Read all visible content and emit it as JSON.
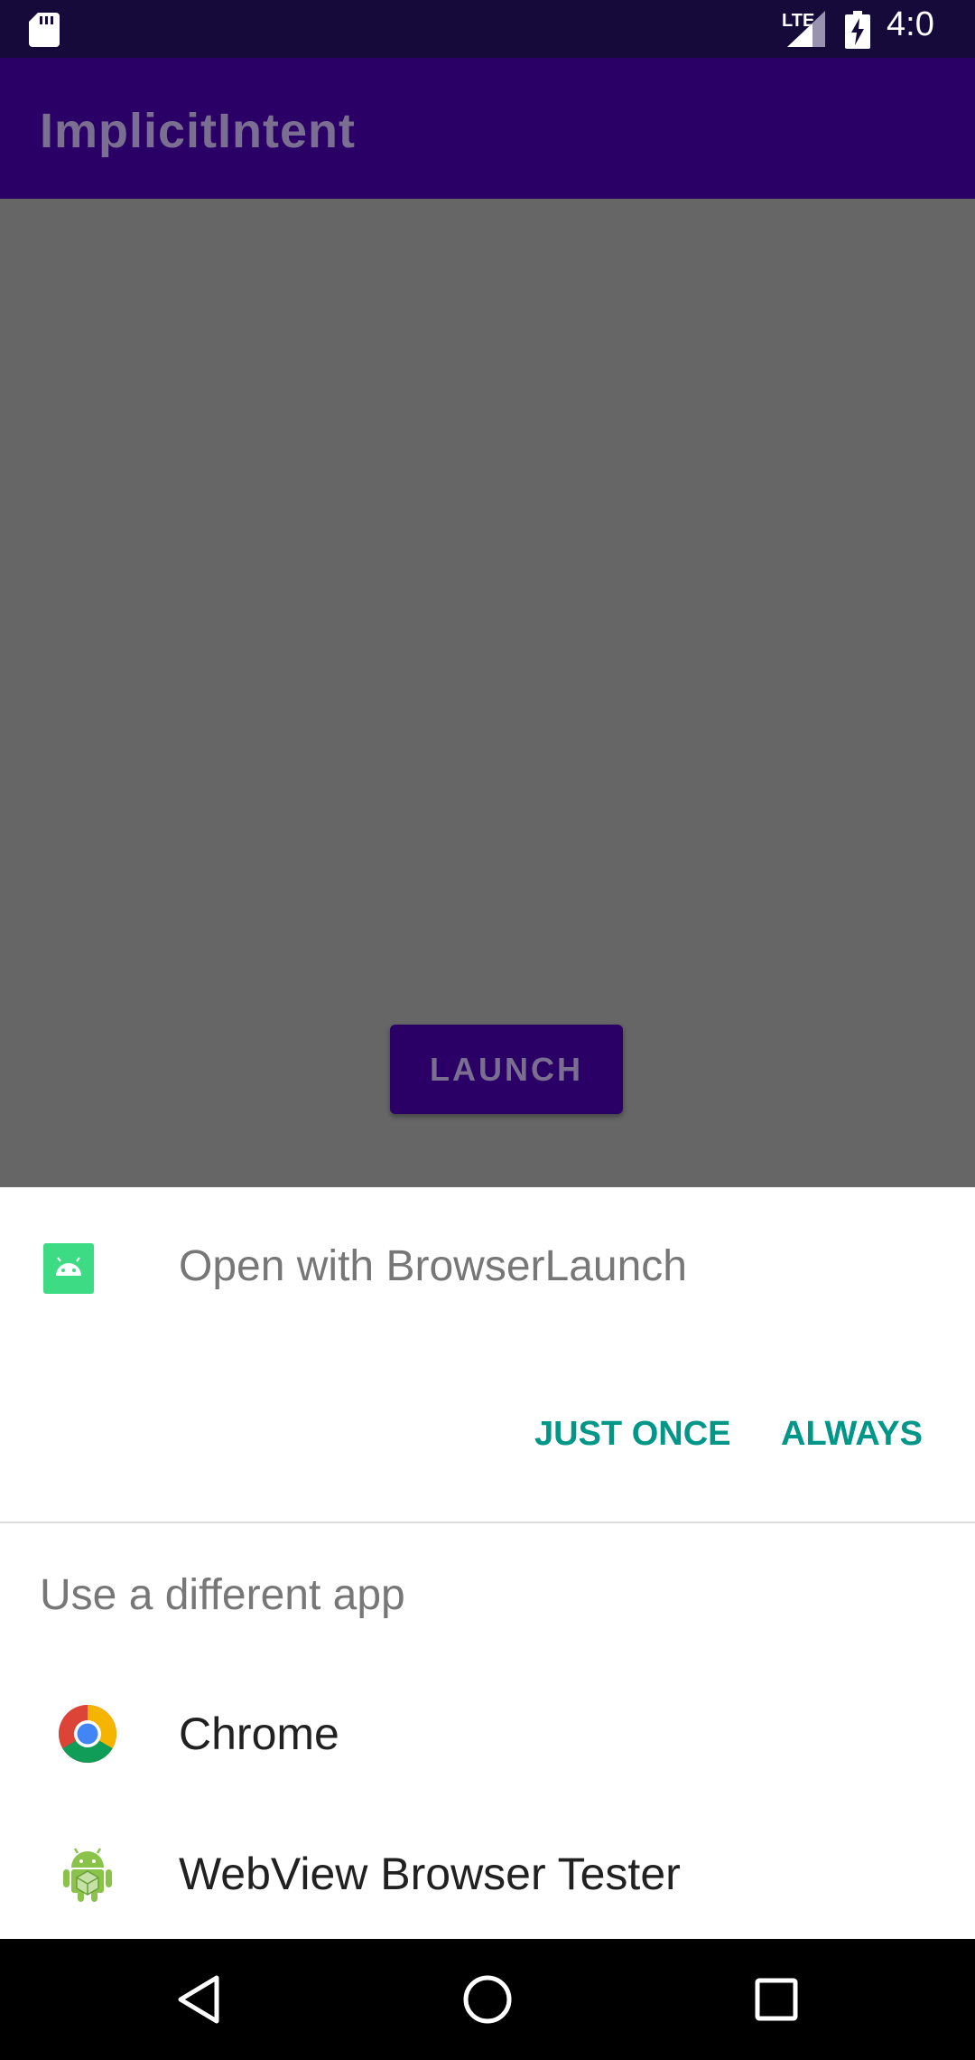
{
  "status_bar": {
    "time": "4:0",
    "network": "LTE",
    "icons": [
      "sd-card-icon",
      "signal-icon",
      "battery-charging-icon"
    ]
  },
  "app_bar": {
    "title": "ImplicitIntent"
  },
  "main": {
    "launch_label": "LAUNCH"
  },
  "chooser": {
    "title": "Open with BrowserLaunch",
    "just_once_label": "JUST ONCE",
    "always_label": "ALWAYS",
    "different_app_label": "Use a different app",
    "apps": [
      {
        "label": "Chrome",
        "icon": "chrome-icon"
      },
      {
        "label": "WebView Browser Tester",
        "icon": "android-webview-icon"
      }
    ]
  },
  "nav_bar": {
    "icons": [
      "back-icon",
      "home-icon",
      "recents-icon"
    ]
  },
  "colors": {
    "status_bar_bg": "#160a3a",
    "app_bar_bg": "#2b0066",
    "scrim_bg": "#666666",
    "accent": "#009688"
  }
}
